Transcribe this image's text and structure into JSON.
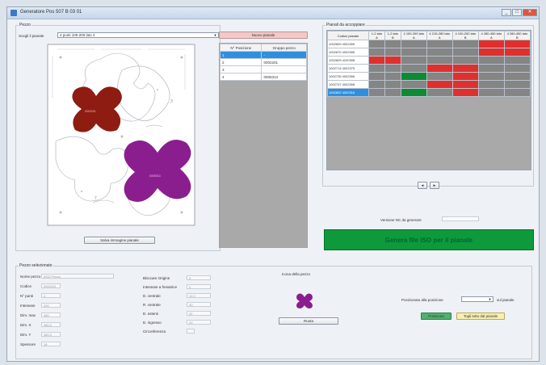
{
  "window": {
    "title": "Generatore Pos 507 B 03 01"
  },
  "pezzo": {
    "group_label": "Pezzo",
    "scelta_label": "Scegli il pianale",
    "scelta_value": "4 punti 100-200 lato 4",
    "save_image_button": "Salva immagine pianale"
  },
  "nuovo_pianale_button": "Nuovo pianale",
  "pos_grid": {
    "headers": [
      "N° Posizione",
      "Gruppo pezzo"
    ],
    "rows": [
      [
        "1",
        "-"
      ],
      [
        "2",
        "0002201"
      ],
      [
        "3",
        ""
      ],
      [
        "4",
        "0005313"
      ]
    ]
  },
  "pianali": {
    "group_label": "Pianali da accoppiare",
    "col0": "Codice pianale",
    "columns": [
      "1-2 lato A",
      "1-2 lato B",
      "4 100-200 lato A",
      "4 215-280 lato A",
      "4 100-200 lato B",
      "4 280-450 lato A",
      "4 280-450 lato B"
    ],
    "rows": [
      {
        "code": "1002659 4002309",
        "cells": [
          "g",
          "g",
          "g",
          "g",
          "g",
          "r",
          "r"
        ]
      },
      {
        "code": "1002670 4002306",
        "cells": [
          "g",
          "g",
          "g",
          "g",
          "g",
          "r",
          "r"
        ]
      },
      {
        "code": "1002609 4240308",
        "cells": [
          "r",
          "r",
          "g",
          "g",
          "g",
          "g",
          "g"
        ]
      },
      {
        "code": "1002714 4002375",
        "cells": [
          "g",
          "g",
          "g",
          "r",
          "r",
          "g",
          "g"
        ]
      },
      {
        "code": "1002735 4002306",
        "cells": [
          "g",
          "g",
          "gr",
          "g",
          "r",
          "g",
          "g"
        ]
      },
      {
        "code": "1002747 4002308",
        "cells": [
          "g",
          "g",
          "g",
          "r",
          "r",
          "g",
          "g"
        ]
      },
      {
        "code": "1002802 4002316",
        "cells": [
          "g",
          "g",
          "gr",
          "g",
          "r",
          "g",
          "g"
        ],
        "selected": true
      }
    ]
  },
  "nc_label": "Versione NC da generare",
  "nc_value": "",
  "generate_button": "Genera file ISO per il pianale",
  "pezzo_selez": {
    "group_label": "Pezzo selezionato",
    "left": [
      {
        "label": "Nome pezzo",
        "value": "0002 Pezzo"
      },
      {
        "label": "Codice",
        "value": "0002201"
      },
      {
        "label": "N° punti",
        "value": "4"
      },
      {
        "label": "Interasse",
        "value": "200"
      },
      {
        "label": "Dim. max",
        "value": "480"
      },
      {
        "label": "Dim. X",
        "value": "380.0"
      },
      {
        "label": "Dim. Y",
        "value": "380.0"
      },
      {
        "label": "Spessore",
        "value": "18"
      }
    ],
    "right": [
      {
        "label": "Bloccare Origine",
        "value": "0"
      },
      {
        "label": "Interasse a fresatrice",
        "value": "0"
      },
      {
        "label": "D. centrale",
        "value": "19.0"
      },
      {
        "label": "R. centrale",
        "value": "20"
      },
      {
        "label": "D. esterni",
        "value": "32"
      },
      {
        "label": "D. ingresso",
        "value": "20"
      },
      {
        "label": "Circonferenza",
        "value": ""
      }
    ]
  },
  "preview_label": "Icona della pezzo",
  "ruota_button": "Ruota",
  "posizionato": {
    "label": "Posizionato alla posizione",
    "suffix": "sul pianale"
  },
  "posiziona_button": "Posiziona",
  "togli_button": "Togli tutto dal pianale",
  "colors": {
    "green": "#0e9a3c",
    "grey": "#858585",
    "red": "#e0302e",
    "mid_green": "#0f8a34",
    "maroon": "#8e1c12",
    "purple": "#8a1e8f"
  }
}
